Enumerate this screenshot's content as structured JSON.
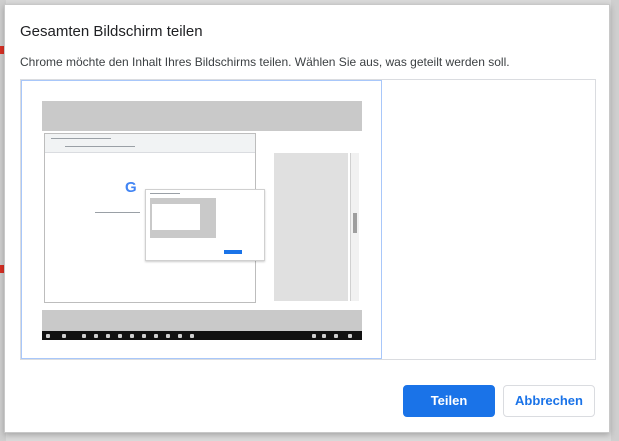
{
  "dialog": {
    "title": "Gesamten Bildschirm teilen",
    "description": "Chrome möchte den Inhalt Ihres Bildschirms teilen. Wählen Sie aus, was geteilt werden soll.",
    "share_label": "Teilen",
    "cancel_label": "Abbrechen"
  },
  "colors": {
    "primary": "#1a73e8",
    "selection_border": "#a8c7fa",
    "taskbar": "#111111"
  },
  "thumbnail": {
    "logo_fragment": "G"
  }
}
